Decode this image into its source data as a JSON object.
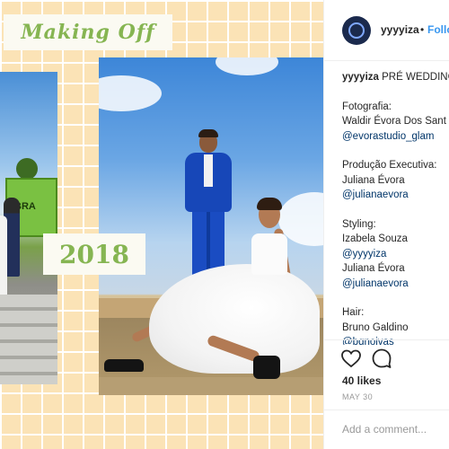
{
  "post": {
    "title_badge": "Making Off",
    "year_badge": "2018",
    "left_photo_sign": "BRA"
  },
  "header": {
    "username": "yyyyiza",
    "separator": "•",
    "follow_label": "Follo"
  },
  "caption": {
    "username": "yyyyiza",
    "text": "PRÉ WEDDING",
    "sections": [
      {
        "heading": "Fotografia:",
        "lines": [
          {
            "text": "Waldir Évora Dos Sant",
            "link": false
          },
          {
            "text": "@evorastudio_glam",
            "link": true
          }
        ]
      },
      {
        "heading": "Produção Executiva:",
        "lines": [
          {
            "text": "Juliana Évora",
            "link": false
          },
          {
            "text": "@julianaevora",
            "link": true
          }
        ]
      },
      {
        "heading": "Styling:",
        "lines": [
          {
            "text": "Izabela Souza",
            "link": false
          },
          {
            "text": "@yyyyiza",
            "link": true
          },
          {
            "text": "Juliana Évora",
            "link": false
          },
          {
            "text": "@julianaevora",
            "link": true
          }
        ]
      },
      {
        "heading": "Hair:",
        "lines": [
          {
            "text": "Bruno Galdino",
            "link": false
          },
          {
            "text": "@bgnoivas",
            "link": true
          }
        ]
      }
    ]
  },
  "actions": {
    "like_icon": "heart-outline-icon",
    "comment_icon": "comment-bubble-icon",
    "likes": "40 likes",
    "date": "MAY 30"
  },
  "comment_box": {
    "placeholder": "Add a comment..."
  },
  "colors": {
    "link": "#003569",
    "follow": "#3897f0",
    "badge_text": "#86b552",
    "grid_bg": "#fbe3b6"
  }
}
